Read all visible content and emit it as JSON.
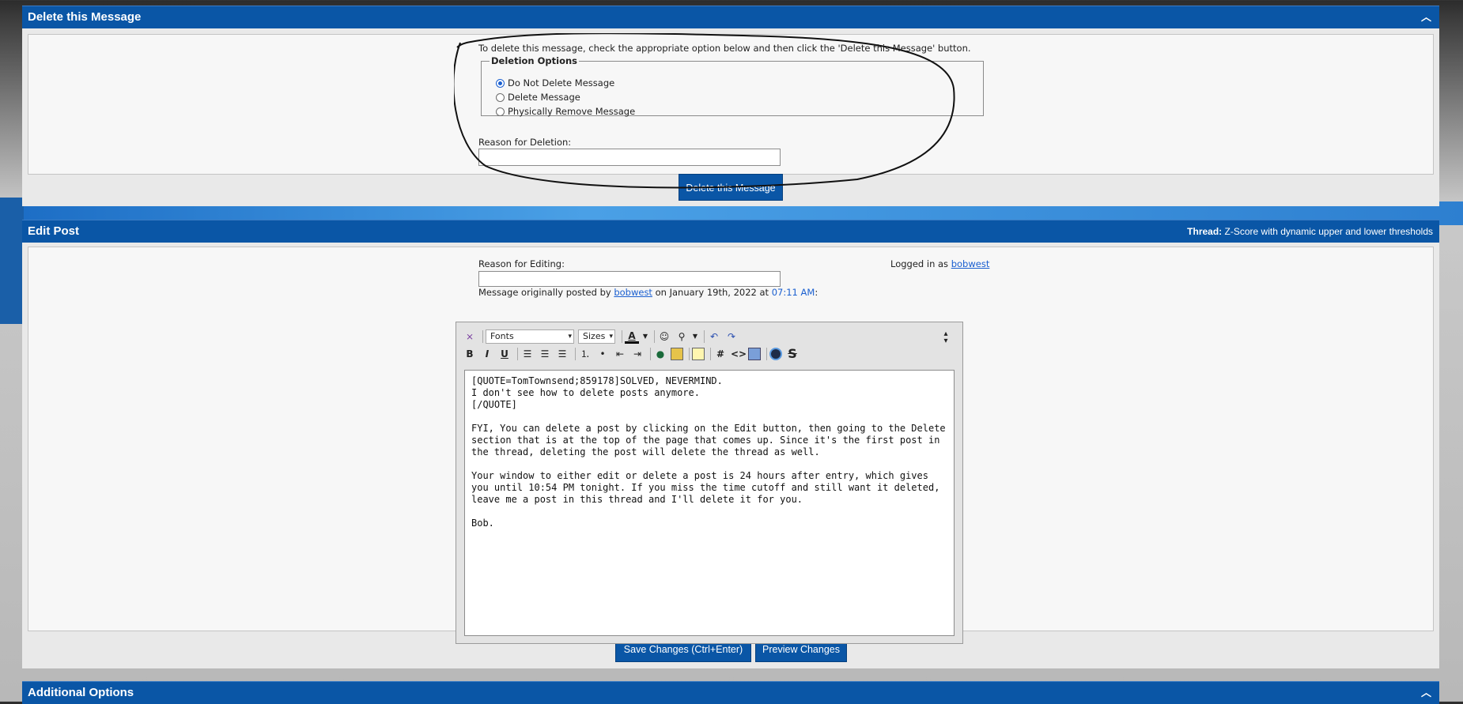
{
  "delete_section": {
    "title": "Delete this Message",
    "instructions": "To delete this message, check the appropriate option below and then click the 'Delete this Message' button.",
    "options_legend": "Deletion Options",
    "options": [
      {
        "label": "Do Not Delete Message",
        "selected": true
      },
      {
        "label": "Delete Message",
        "selected": false
      },
      {
        "label": "Physically Remove Message",
        "selected": false
      }
    ],
    "reason_label": "Reason for Deletion:",
    "reason_value": "",
    "button_label": "Delete this Message"
  },
  "edit_section": {
    "title": "Edit Post",
    "thread_prefix": "Thread:",
    "thread_title": "Z-Score with dynamic upper and lower thresholds",
    "reason_label": "Reason for Editing:",
    "reason_value": "",
    "logged_in_prefix": "Logged in as",
    "logged_in_user": "bobwest",
    "orig_prefix": "Message originally posted by",
    "orig_user": "bobwest",
    "orig_on": "on January 19th, 2022 at",
    "orig_time": "07:11 AM",
    "orig_suffix": ":",
    "fonts_select": "Fonts",
    "sizes_select": "Sizes",
    "message_text": "[QUOTE=TomTownsend;859178]SOLVED, NEVERMIND.\nI don't see how to delete posts anymore.\n[/QUOTE]\n\nFYI, You can delete a post by clicking on the Edit button, then going to the Delete section that is at the top of the page that comes up. Since it's the first post in the thread, deleting the post will delete the thread as well.\n\nYour window to either edit or delete a post is 24 hours after entry, which gives you until 10:54 PM tonight. If you miss the time cutoff and still want it deleted, leave me a post in this thread and I'll delete it for you.\n\nBob.",
    "save_button": "Save Changes (Ctrl+Enter)",
    "preview_button": "Preview Changes"
  },
  "additional_section": {
    "title": "Additional Options"
  },
  "colors": {
    "header_blue": "#0a56a6",
    "link_blue": "#1a5fd0"
  },
  "icons": [
    "collapse-icon",
    "remove-format-icon",
    "bold-icon",
    "italic-icon",
    "underline-icon",
    "align-left-icon",
    "align-center-icon",
    "align-right-icon",
    "ordered-list-icon",
    "unordered-list-icon",
    "outdent-icon",
    "indent-icon",
    "link-icon",
    "image-icon",
    "quote-icon",
    "hash-icon",
    "code-icon",
    "php-icon",
    "video-icon",
    "strike-icon",
    "smiley-icon",
    "attach-icon",
    "undo-icon",
    "redo-icon",
    "text-color-icon",
    "resize-icon"
  ]
}
